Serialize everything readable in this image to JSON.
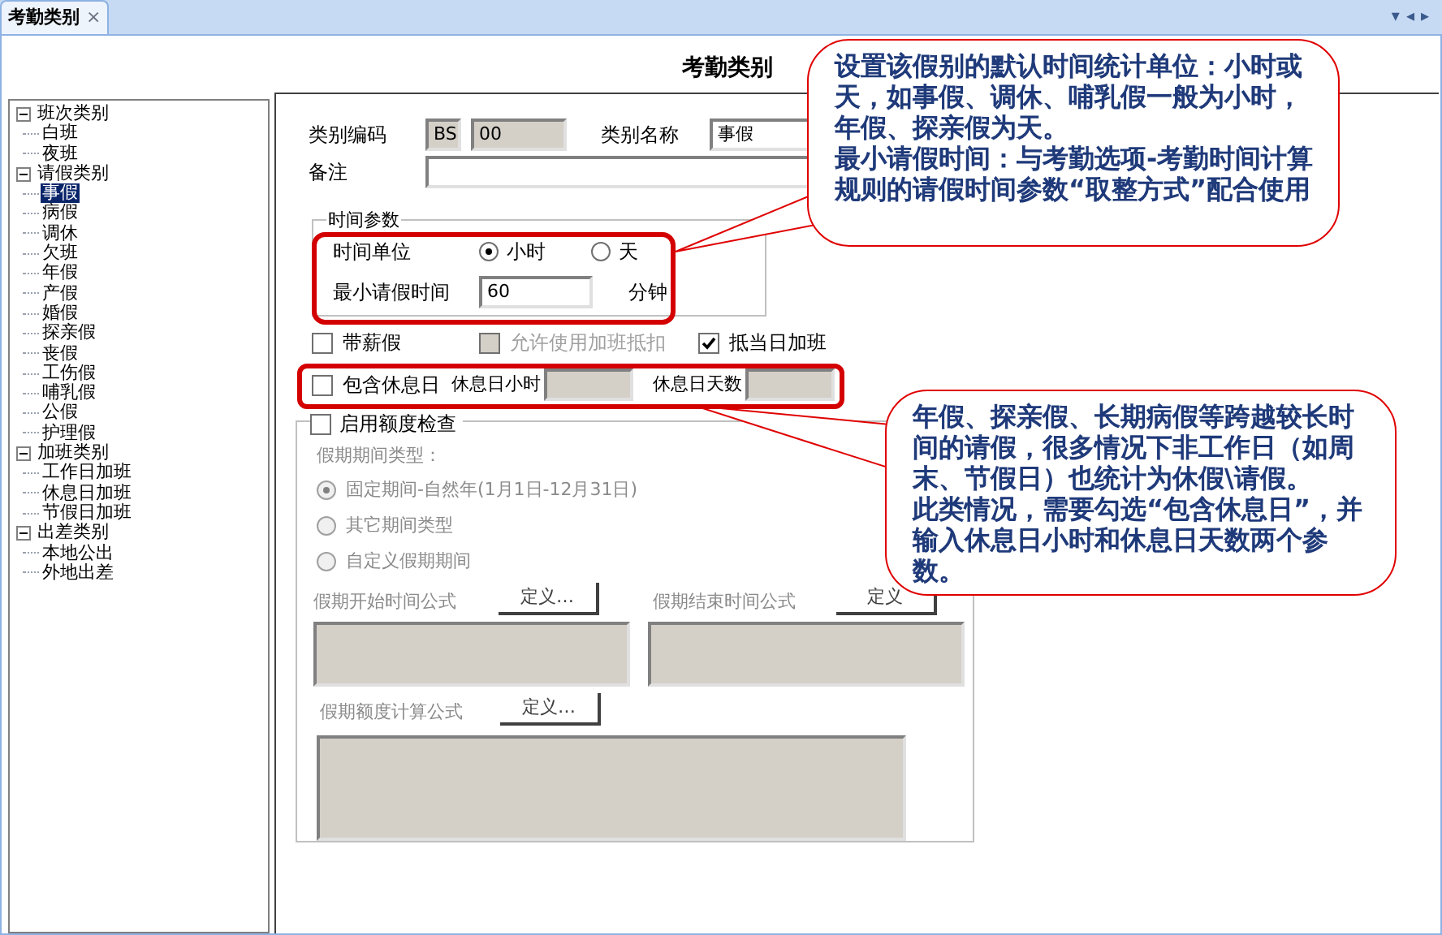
{
  "tab": {
    "label": "考勤类别",
    "close": "×",
    "selected": true
  },
  "tab_controls": [
    "▾",
    "◂",
    "▸"
  ],
  "title": "考勤类别",
  "tree": [
    {
      "label": "班次类别",
      "expanded": true,
      "selected": false,
      "children": [
        {
          "label": "白班",
          "selected": false
        },
        {
          "label": "夜班",
          "selected": false
        }
      ]
    },
    {
      "label": "请假类别",
      "expanded": true,
      "selected": false,
      "children": [
        {
          "label": "事假",
          "selected": true
        },
        {
          "label": "病假",
          "selected": false
        },
        {
          "label": "调休",
          "selected": false
        },
        {
          "label": "欠班",
          "selected": false
        },
        {
          "label": "年假",
          "selected": false
        },
        {
          "label": "产假",
          "selected": false
        },
        {
          "label": "婚假",
          "selected": false
        },
        {
          "label": "探亲假",
          "selected": false
        },
        {
          "label": "丧假",
          "selected": false
        },
        {
          "label": "工伤假",
          "selected": false
        },
        {
          "label": "哺乳假",
          "selected": false
        },
        {
          "label": "公假",
          "selected": false
        },
        {
          "label": "护理假",
          "selected": false
        }
      ]
    },
    {
      "label": "加班类别",
      "expanded": true,
      "selected": false,
      "children": [
        {
          "label": "工作日加班",
          "selected": false
        },
        {
          "label": "休息日加班",
          "selected": false
        },
        {
          "label": "节假日加班",
          "selected": false
        }
      ]
    },
    {
      "label": "出差类别",
      "expanded": true,
      "selected": false,
      "children": [
        {
          "label": "本地公出",
          "selected": false
        },
        {
          "label": "外地出差",
          "selected": false
        }
      ]
    }
  ],
  "form": {
    "code": {
      "label": "类别编码",
      "prefix": "BS",
      "value": "00"
    },
    "name": {
      "label": "类别名称",
      "value": "事假"
    },
    "memo": {
      "label": "备注"
    },
    "time_params": {
      "title": "时间参数",
      "unit_label": "时间单位",
      "units": [
        {
          "label": "小时",
          "selected": true
        },
        {
          "label": "天",
          "selected": false
        }
      ],
      "min_label": "最小请假时间",
      "min_value": "60",
      "min_suffix": "分钟"
    },
    "checkboxes": [
      {
        "label": "带薪假",
        "checked": false,
        "disabled": false
      },
      {
        "label": "允许使用加班抵扣",
        "checked": false,
        "disabled": true
      },
      {
        "label": "抵当日加班",
        "checked": true,
        "disabled": false
      }
    ],
    "rest_day": {
      "label": "包含休息日",
      "checked": false,
      "hours_label": "休息日小时",
      "days_label": "休息日天数"
    },
    "quota": {
      "label": "启用额度检查",
      "checked": false,
      "period_label": "假期期间类型：",
      "periods": [
        {
          "label": "固定期间-自然年(1月1日-12月31日)",
          "selected": true
        },
        {
          "label": "其它期间类型",
          "selected": false
        },
        {
          "label": "自定义假期期间",
          "selected": false
        }
      ],
      "start_label": "假期开始时间公式",
      "start_button": "定义…",
      "end_label": "假期结束时间公式",
      "end_button": "定义",
      "amount_label": "假期额度计算公式",
      "amount_button": "定义…"
    }
  },
  "callouts": [
    {
      "paragraphs": [
        "设置该假别的默认时间统计单位：小时或天，如事假、调休、哺乳假一般为小时，年假、探亲假为天。",
        "最小请假时间：与考勤选项-考勤时间计算规则的请假时间参数“取整方式”配合使用"
      ]
    },
    {
      "paragraphs": [
        "年假、探亲假、长期病假等跨越较长时间的请假，很多情况下非工作日（如周末、节假日）也统计为休假\\请假。",
        "此类情况，需要勾选“包含休息日”，并输入休息日小时和休息日天数两个参数。"
      ]
    }
  ]
}
